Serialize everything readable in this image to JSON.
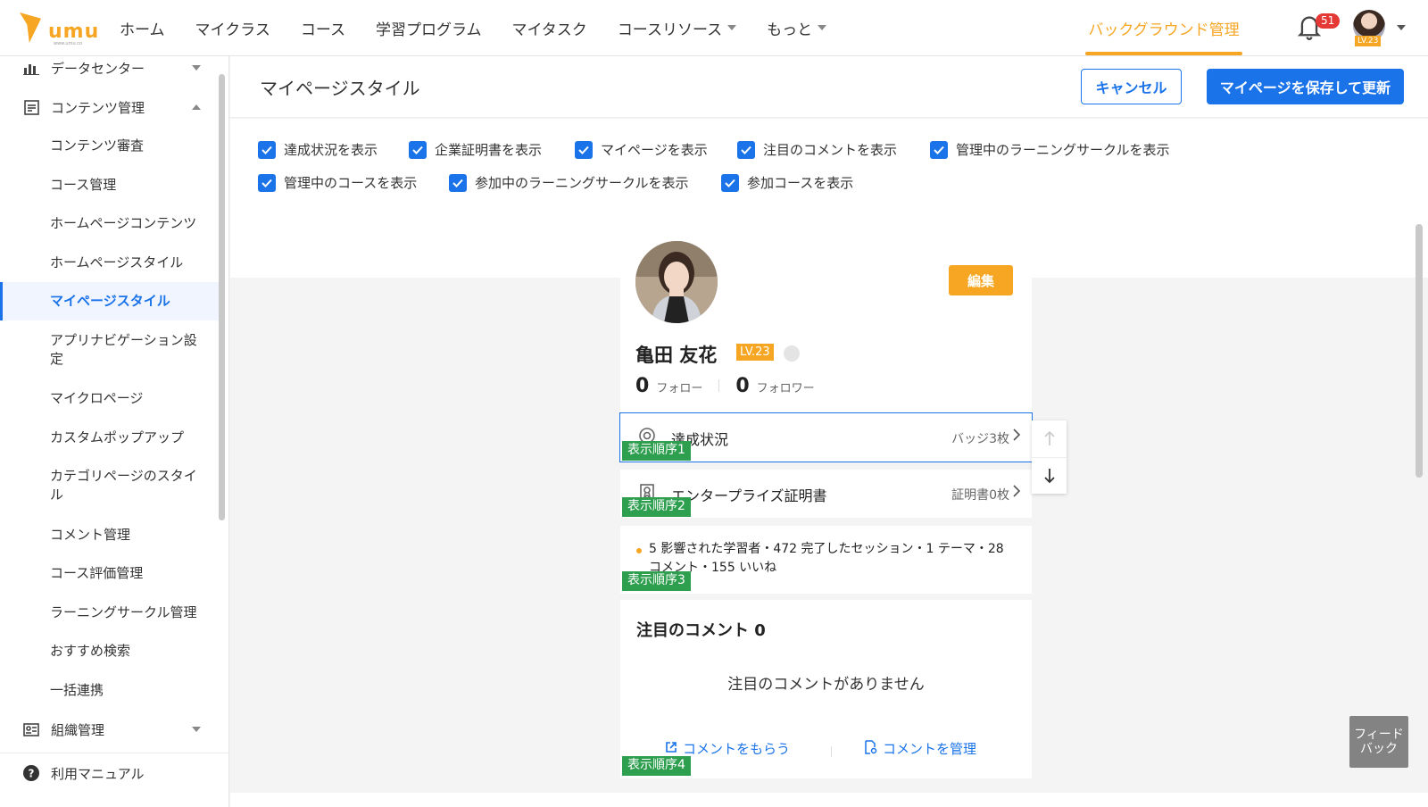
{
  "brand": {
    "logo_text": "umu",
    "logo_sub": "www.umu.co"
  },
  "topnav": {
    "items": [
      "ホーム",
      "マイクラス",
      "コース",
      "学習プログラム",
      "マイタスク",
      "コースリソース",
      "もっと"
    ],
    "admin_label": "バックグラウンド管理",
    "notification_count": "51",
    "user_level": "LV.23",
    "accent_color": "#f6a623"
  },
  "sidebar": {
    "data_center": "データセンター",
    "content_mgmt": "コンテンツ管理",
    "items": [
      "コンテンツ審査",
      "コース管理",
      "ホームページコンテンツ",
      "ホームページスタイル",
      "マイページスタイル",
      "アプリナビゲーション設定",
      "マイクロページ",
      "カスタムポップアップ",
      "カテゴリページのスタイル",
      "コメント管理",
      "コース評価管理",
      "ラーニングサークル管理",
      "おすすめ検索",
      "一括連携"
    ],
    "active_item": "マイページスタイル",
    "org_mgmt": "組織管理",
    "manual": "利用マニュアル"
  },
  "header": {
    "title": "マイページスタイル",
    "cancel_label": "キャンセル",
    "save_label": "マイページを保存して更新",
    "primary_color": "#1a73e8"
  },
  "options": [
    {
      "label": "達成状況を表示",
      "checked": true
    },
    {
      "label": "企業証明書を表示",
      "checked": true
    },
    {
      "label": "マイページを表示",
      "checked": true
    },
    {
      "label": "注目のコメントを表示",
      "checked": true
    },
    {
      "label": "管理中のラーニングサークルを表示",
      "checked": true
    },
    {
      "label": "管理中のコースを表示",
      "checked": true
    },
    {
      "label": "参加中のラーニングサークルを表示",
      "checked": true
    },
    {
      "label": "参加コースを表示",
      "checked": true
    }
  ],
  "profile": {
    "name": "亀田 友花",
    "level": "LV.23",
    "edit_label": "編集",
    "following_count": "0",
    "following_label": "フォロー",
    "followers_count": "0",
    "followers_label": "フォロワー"
  },
  "sections": {
    "achievement": {
      "label": "達成状況",
      "value": "バッジ3枚",
      "order": "表示順序1"
    },
    "certificate": {
      "label": "エンタープライズ証明書",
      "value": "証明書0枚",
      "order": "表示順序2"
    },
    "stats": {
      "text": "5 影響された学習者・472 完了したセッション・1 テーマ・28 コメント・155 いいね",
      "order": "表示順序3"
    },
    "comments": {
      "title": "注目のコメント 0",
      "empty": "注目のコメントがありません",
      "get_link": "コメントをもらう",
      "manage_link": "コメントを管理",
      "order": "表示順序4"
    }
  },
  "feedback_label": "フィードバック",
  "order_tag_color": "#2e9e4f"
}
